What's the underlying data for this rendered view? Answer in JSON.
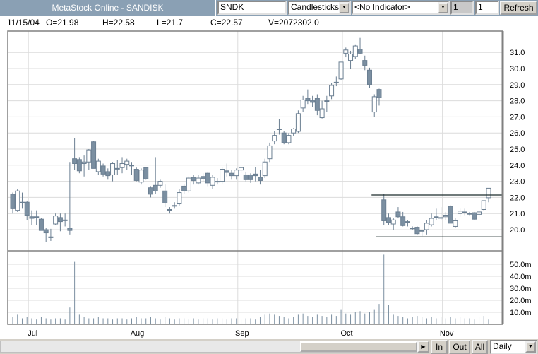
{
  "header": {
    "title": "MetaStock Online - SANDISK",
    "symbol": "SNDK",
    "chart_type": "Candlesticks",
    "indicator": "<No Indicator>",
    "field1": "1",
    "field2": "1",
    "refresh_label": "Refresh"
  },
  "info": {
    "date": "11/15/04",
    "open": "O=21.98",
    "high": "H=22.58",
    "low": "L=21.7",
    "close": "C=22.57",
    "volume": "V=2072302.0"
  },
  "footer": {
    "in_label": "In",
    "out_label": "Out",
    "all_label": "All",
    "period": "Daily"
  },
  "colors": {
    "candle": "#7b8fa1",
    "grid": "#dcdcdc",
    "frame": "#808080",
    "title_bg": "#8aa0b4"
  },
  "chart_data": {
    "type": "candlestick",
    "price_ylim": [
      19,
      32
    ],
    "price_ticks": [
      "20.0",
      "21.0",
      "22.0",
      "23.0",
      "24.0",
      "25.0",
      "26.0",
      "27.0",
      "28.0",
      "29.0",
      "30.0",
      "31.0"
    ],
    "volume_ylim": [
      0,
      60
    ],
    "volume_ticks": [
      "10.0m",
      "20.0m",
      "30.0m",
      "40.0m",
      "50.0m"
    ],
    "months": [
      {
        "label": "Jul",
        "index": 3
      },
      {
        "label": "Aug",
        "index": 25
      },
      {
        "label": "Sep",
        "index": 47
      },
      {
        "label": "Oct",
        "index": 69
      },
      {
        "label": "Nov",
        "index": 90
      }
    ],
    "trendlines": [
      {
        "price": 22.15,
        "from_index": 76
      },
      {
        "price": 19.55,
        "from_index": 77
      }
    ],
    "ohlc": [
      [
        22.2,
        22.3,
        21.0,
        21.3
      ],
      [
        21.2,
        22.5,
        21.1,
        22.4
      ],
      [
        21.7,
        22.3,
        21.3,
        21.7
      ],
      [
        21.7,
        21.8,
        20.6,
        20.9
      ],
      [
        20.8,
        21.2,
        20.3,
        20.7
      ],
      [
        20.8,
        21.2,
        20.3,
        20.8
      ],
      [
        20.65,
        20.7,
        19.95,
        19.95
      ],
      [
        20.0,
        20.1,
        19.25,
        19.8
      ],
      [
        19.5,
        20.05,
        19.3,
        19.55
      ],
      [
        20.35,
        21.0,
        20.3,
        20.85
      ],
      [
        20.75,
        21.0,
        19.9,
        20.5
      ],
      [
        20.6,
        21.0,
        20.2,
        20.6
      ],
      [
        20.1,
        24.2,
        19.7,
        19.95
      ],
      [
        24.4,
        25.7,
        23.7,
        24.1
      ],
      [
        24.35,
        24.5,
        23.5,
        23.65
      ],
      [
        24.1,
        24.6,
        23.3,
        24.2
      ],
      [
        24.2,
        25.0,
        23.7,
        24.95
      ],
      [
        25.45,
        25.5,
        23.8,
        23.8
      ],
      [
        23.6,
        24.4,
        23.4,
        24.25
      ],
      [
        23.95,
        24.1,
        23.3,
        23.45
      ],
      [
        23.6,
        23.8,
        23.1,
        23.35
      ],
      [
        23.4,
        24.2,
        23.0,
        24.1
      ],
      [
        23.8,
        24.3,
        23.4,
        23.8
      ],
      [
        23.85,
        24.5,
        23.5,
        24.1
      ],
      [
        24.05,
        24.4,
        23.7,
        24.25
      ],
      [
        24.0,
        24.2,
        23.4,
        24.0
      ],
      [
        23.75,
        23.85,
        23.0,
        23.05
      ],
      [
        22.95,
        23.8,
        22.8,
        23.7
      ],
      [
        23.85,
        23.9,
        23.1,
        23.15
      ],
      [
        22.6,
        22.7,
        22.0,
        22.2
      ],
      [
        22.75,
        24.5,
        22.2,
        22.4
      ],
      [
        22.75,
        23.1,
        22.6,
        23.0
      ],
      [
        22.4,
        22.8,
        21.4,
        21.65
      ],
      [
        21.25,
        21.4,
        21.0,
        21.2
      ],
      [
        21.5,
        21.7,
        21.3,
        21.5
      ],
      [
        21.6,
        22.5,
        21.5,
        22.3
      ],
      [
        22.7,
        22.8,
        22.2,
        22.4
      ],
      [
        22.4,
        23.3,
        22.3,
        23.2
      ],
      [
        23.25,
        23.4,
        22.8,
        23.05
      ],
      [
        22.9,
        23.4,
        22.8,
        23.2
      ],
      [
        23.3,
        23.5,
        23.0,
        23.15
      ],
      [
        23.5,
        23.6,
        22.7,
        22.9
      ],
      [
        22.75,
        23.4,
        22.5,
        23.25
      ],
      [
        23.0,
        23.2,
        22.8,
        23.0
      ],
      [
        23.0,
        23.9,
        22.8,
        23.75
      ],
      [
        23.65,
        24.1,
        23.3,
        23.55
      ],
      [
        23.5,
        23.7,
        23.1,
        23.35
      ],
      [
        23.35,
        23.8,
        23.1,
        23.7
      ],
      [
        23.7,
        23.9,
        23.5,
        23.85
      ],
      [
        23.4,
        23.6,
        23.0,
        23.1
      ],
      [
        23.4,
        23.5,
        22.9,
        23.1
      ],
      [
        23.45,
        23.9,
        23.0,
        23.35
      ],
      [
        23.25,
        23.7,
        22.8,
        23.05
      ],
      [
        23.35,
        24.4,
        23.2,
        24.2
      ],
      [
        24.4,
        25.4,
        24.2,
        25.2
      ],
      [
        25.5,
        26.1,
        25.3,
        25.85
      ],
      [
        26.25,
        26.85,
        25.9,
        26.25
      ],
      [
        26.0,
        26.1,
        25.3,
        25.4
      ],
      [
        25.4,
        26.0,
        25.3,
        25.85
      ],
      [
        26.0,
        26.3,
        25.8,
        26.25
      ],
      [
        26.1,
        27.4,
        26.0,
        27.2
      ],
      [
        27.55,
        28.3,
        27.3,
        28.05
      ],
      [
        28.15,
        28.7,
        27.8,
        28.0
      ],
      [
        28.0,
        28.3,
        27.6,
        27.9
      ],
      [
        28.15,
        28.4,
        27.1,
        27.4
      ],
      [
        26.95,
        28.0,
        26.9,
        27.5
      ],
      [
        28.0,
        28.3,
        27.3,
        28.0
      ],
      [
        28.3,
        29.1,
        28.1,
        28.95
      ],
      [
        29.15,
        29.5,
        28.9,
        29.15
      ],
      [
        29.35,
        30.4,
        29.3,
        30.4
      ],
      [
        30.95,
        31.3,
        30.7,
        31.15
      ],
      [
        30.5,
        31.1,
        30.0,
        30.9
      ],
      [
        30.75,
        31.5,
        30.6,
        31.4
      ],
      [
        31.2,
        31.9,
        30.9,
        30.95
      ],
      [
        30.5,
        30.8,
        29.9,
        30.2
      ],
      [
        29.9,
        30.05,
        28.8,
        29.0
      ],
      [
        27.3,
        28.4,
        27.0,
        28.25
      ],
      [
        28.7,
        28.75,
        27.7,
        28.2
      ],
      [
        21.85,
        22.2,
        20.3,
        20.55
      ],
      [
        20.75,
        21.0,
        20.3,
        20.45
      ],
      [
        20.35,
        20.7,
        20.0,
        20.6
      ],
      [
        21.1,
        21.4,
        20.7,
        20.8
      ],
      [
        20.8,
        21.1,
        20.2,
        20.25
      ],
      [
        20.5,
        20.6,
        20.2,
        20.5
      ],
      [
        20.1,
        20.2,
        20.0,
        20.1
      ],
      [
        20.15,
        20.2,
        19.7,
        19.75
      ],
      [
        19.95,
        20.0,
        19.6,
        19.9
      ],
      [
        20.0,
        20.6,
        19.7,
        20.4
      ],
      [
        20.3,
        21.0,
        20.2,
        20.7
      ],
      [
        20.8,
        21.3,
        20.6,
        20.8
      ],
      [
        20.75,
        21.4,
        20.6,
        20.75
      ],
      [
        20.8,
        21.1,
        20.6,
        20.9
      ],
      [
        21.45,
        21.5,
        20.4,
        20.4
      ],
      [
        20.2,
        20.7,
        20.1,
        20.55
      ],
      [
        21.0,
        21.3,
        20.8,
        21.15
      ],
      [
        21.1,
        21.3,
        20.9,
        21.1
      ],
      [
        21.0,
        21.1,
        20.9,
        21.0
      ],
      [
        21.05,
        21.1,
        20.6,
        20.65
      ],
      [
        20.95,
        21.2,
        20.7,
        21.1
      ],
      [
        21.25,
        21.8,
        21.2,
        21.8
      ],
      [
        21.98,
        22.58,
        21.7,
        22.57
      ]
    ],
    "volume": [
      6,
      8,
      5,
      6,
      5,
      4,
      6,
      5,
      4,
      5,
      5,
      4,
      14,
      52,
      8,
      6,
      5,
      5,
      6,
      5,
      5,
      4,
      5,
      5,
      4,
      5,
      6,
      5,
      5,
      6,
      5,
      4,
      6,
      5,
      4,
      5,
      5,
      4,
      5,
      4,
      5,
      5,
      4,
      5,
      5,
      4,
      5,
      5,
      4,
      5,
      5,
      4,
      6,
      8,
      9,
      8,
      7,
      6,
      5,
      6,
      8,
      9,
      7,
      6,
      8,
      7,
      6,
      8,
      7,
      12,
      9,
      8,
      10,
      11,
      9,
      10,
      12,
      17,
      58,
      16,
      8,
      7,
      6,
      5,
      6,
      7,
      6,
      5,
      6,
      5,
      6,
      5,
      6,
      5,
      6,
      5,
      5,
      4,
      6,
      7,
      4
    ]
  }
}
